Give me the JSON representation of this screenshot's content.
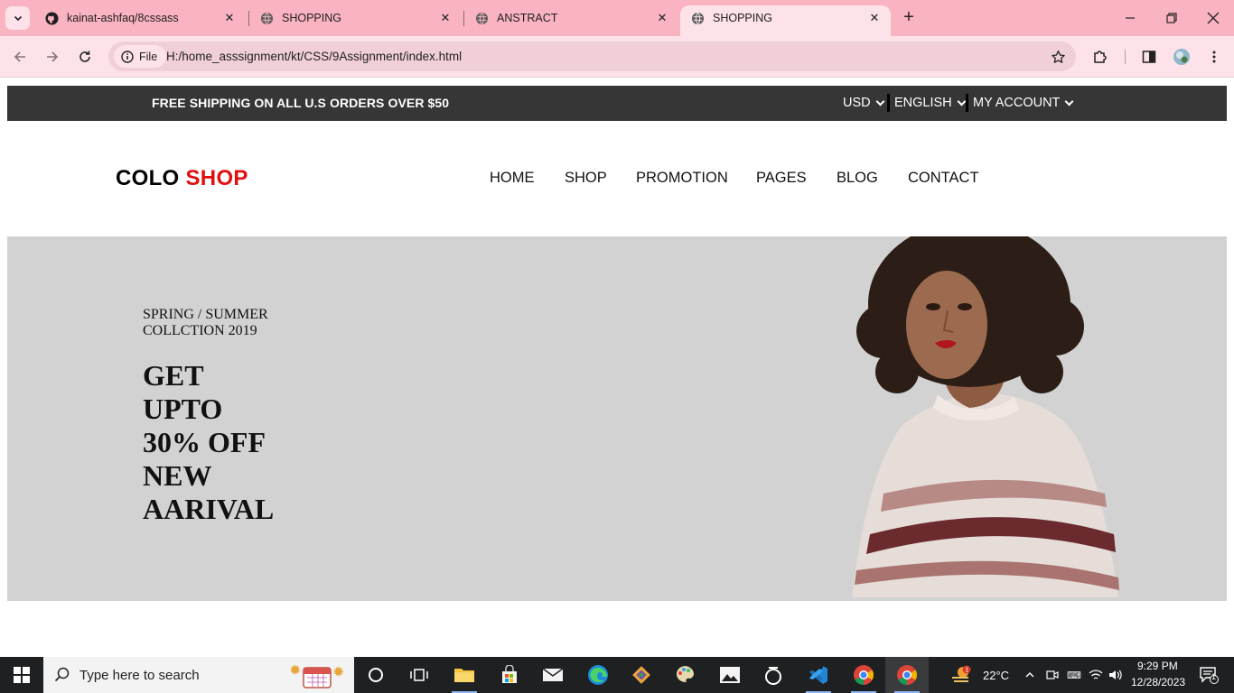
{
  "browser": {
    "tabs": [
      {
        "title": "kainat-ashfaq/8cssass",
        "favicon": "github-icon",
        "active": false
      },
      {
        "title": "SHOPPING",
        "favicon": "globe-icon",
        "active": false
      },
      {
        "title": "ANSTRACT",
        "favicon": "globe-icon",
        "active": false
      },
      {
        "title": "SHOPPING",
        "favicon": "globe-icon",
        "active": true
      }
    ],
    "site_chip_label": "File",
    "url": "H:/home_asssignment/kt/CSS/9Assignment/index.html"
  },
  "page": {
    "topbar": {
      "promo": "FREE SHIPPING ON ALL U.S ORDERS OVER $50",
      "currency": "USD",
      "language": "ENGLISH",
      "account": "MY ACCOUNT"
    },
    "logo": {
      "part1": "COLO ",
      "part2": "SHOP"
    },
    "nav": [
      "HOME",
      "SHOP",
      "PROMOTION",
      "PAGES",
      "BLOG",
      "CONTACT"
    ],
    "hero": {
      "subtitle_line1": "SPRING / SUMMER",
      "subtitle_line2": "COLLCTION 2019",
      "title_lines": [
        "GET",
        "UPTO",
        "30% OFF",
        "NEW",
        "AARIVAL"
      ]
    }
  },
  "taskbar": {
    "search_placeholder": "Type here to search",
    "weather": "22°C",
    "time": "9:29 PM",
    "date": "12/28/2023",
    "notification_count": "1"
  },
  "colors": {
    "tabstrip": "#f9b3c1",
    "toolbar": "#fde3e9",
    "topbar_bg": "#363636",
    "logo_accent": "#e01010",
    "hero_bg": "#d2d2d2"
  }
}
